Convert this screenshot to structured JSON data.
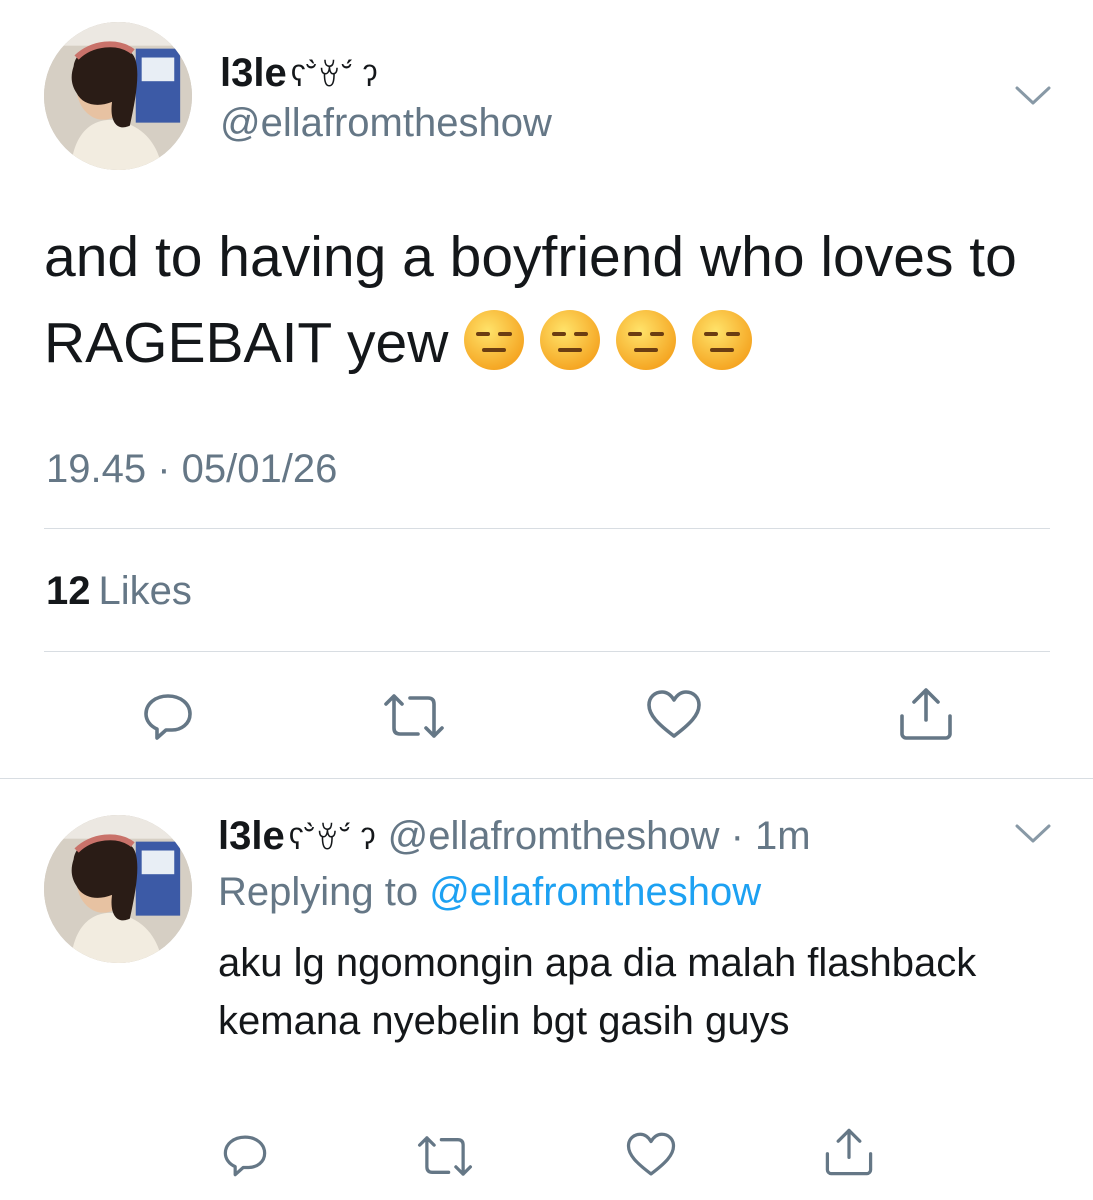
{
  "tweet": {
    "display_name": "l3le",
    "kaomoji": "ʕ˘̀ꈊ˘́ ʔ",
    "handle": "@ellafromtheshow",
    "text": "and to having a boyfriend who loves to RAGEBAIT yew",
    "emojis": [
      "expressionless-face",
      "expressionless-face",
      "expressionless-face",
      "expressionless-face"
    ],
    "timestamp": "19.45 · 05/01/26",
    "likes_count": "12",
    "likes_label": "Likes",
    "actions": [
      "reply-icon",
      "retweet-icon",
      "like-icon",
      "share-icon"
    ]
  },
  "reply": {
    "display_name": "l3le",
    "kaomoji": "ʕ˘̀ꈊ˘́ ʔ",
    "handle": "@ellafromtheshow",
    "dot": "·",
    "time": "1m",
    "replying_prefix": "Replying to",
    "replying_to": "@ellafromtheshow",
    "text": "aku lg ngomongin apa dia malah flashback kemana nyebelin bgt gasih guys",
    "actions": [
      "reply-icon",
      "retweet-icon",
      "like-icon",
      "share-icon"
    ]
  },
  "colors": {
    "text_primary": "#14171a",
    "text_secondary": "#657786",
    "link": "#1da1f2",
    "divider": "#d8dde2"
  }
}
